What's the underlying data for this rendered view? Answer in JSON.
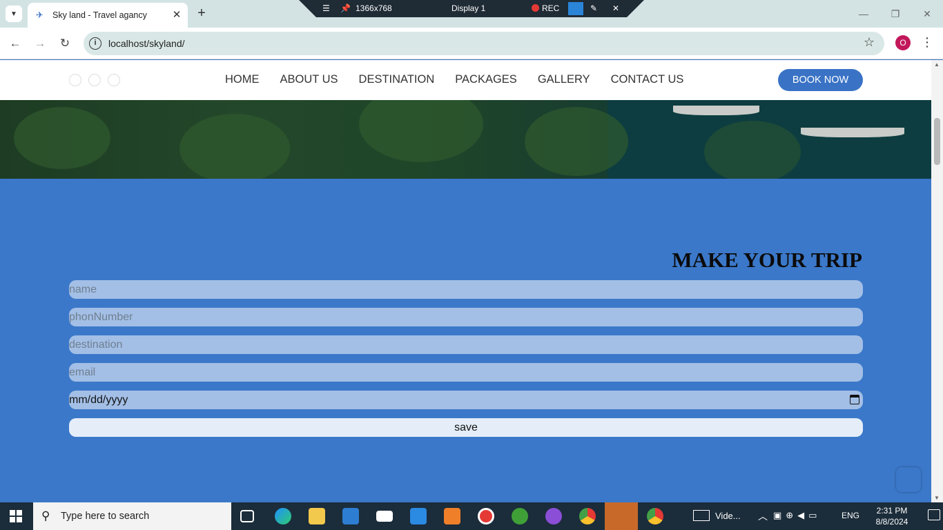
{
  "browser": {
    "tab_title": "Sky land - Travel agancy",
    "url": "localhost/skyland/",
    "profile_initial": "O"
  },
  "recorder": {
    "resolution": "1366x768",
    "display": "Display 1",
    "rec_label": "REC"
  },
  "site": {
    "nav": [
      "HOME",
      "ABOUT US",
      "DESTINATION",
      "PACKAGES",
      "GALLERY",
      "CONTACT US"
    ],
    "book_now": "BOOK NOW",
    "form_title": "MAKE YOUR TRIP",
    "fields": {
      "name_placeholder": "name",
      "phone_placeholder": "phonNumber",
      "destination_placeholder": "destination",
      "email_placeholder": "email",
      "date_placeholder": "mm/dd/yyyy"
    },
    "save_label": "save"
  },
  "colors": {
    "accent": "#3a73c5",
    "section_bg": "#3b78c9",
    "input_bg": "#a3bfe6"
  },
  "taskbar": {
    "search_placeholder": "Type here to search",
    "video_label": "Vide...",
    "language": "ENG",
    "time": "2:31 PM",
    "date": "8/8/2024"
  }
}
